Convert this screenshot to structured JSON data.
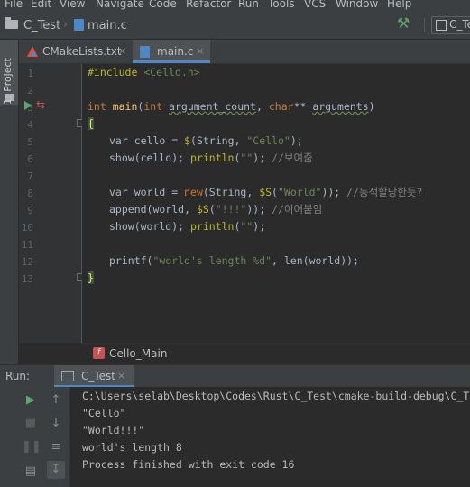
{
  "menu": [
    "File",
    "Edit",
    "View",
    "Navigate",
    "Code",
    "Refactor",
    "Run",
    "Tools",
    "VCS",
    "Window",
    "Help"
  ],
  "navbar": {
    "project": "C_Test",
    "file": "main.c",
    "run_config": "C_Te"
  },
  "sidebar": {
    "project_tab": "1: Project"
  },
  "tabs": [
    {
      "label": "CMakeLists.txt",
      "close": "×"
    },
    {
      "label": "main.c",
      "close": "×"
    }
  ],
  "editor": {
    "line_numbers": [
      "1",
      "2",
      "3",
      "4",
      "5",
      "6",
      "7",
      "8",
      "9",
      "10",
      "11",
      "12",
      "13"
    ],
    "lines": {
      "l1_inc": "#include ",
      "l1_hdr": "<Cello.h>",
      "l3_int1": "int ",
      "l3_main": "main",
      "l3_p1": "(",
      "l3_int2": "int ",
      "l3_argc": "argument_count",
      "l3_comma": ", ",
      "l3_char": "char",
      "l3_stars": "** ",
      "l3_argv": "arguments",
      "l3_close": ")",
      "l4_brace": "{",
      "l5_a": "var cello = ",
      "l5_mac": "$",
      "l5_b": "(String, ",
      "l5_str": "\"Cello\"",
      "l5_c": ");",
      "l6_a": "show(cello); ",
      "l6_fn": "println",
      "l6_b": "(",
      "l6_str": "\"\"",
      "l6_c": "); ",
      "l6_cm": "//보여줌",
      "l8_a": "var world = ",
      "l8_new": "new",
      "l8_b": "(String, ",
      "l8_mac": "$S",
      "l8_c": "(",
      "l8_str": "\"World\"",
      "l8_d": ")); ",
      "l8_cm": "//동적할당한듯?",
      "l9_a": "append(world, ",
      "l9_mac": "$S",
      "l9_b": "(",
      "l9_str": "\"!!!\"",
      "l9_c": ")); ",
      "l9_cm": "//이어붙임",
      "l10_a": "show(world); ",
      "l10_fn": "println",
      "l10_b": "(",
      "l10_str": "\"\"",
      "l10_c": ");",
      "l12_a": "printf(",
      "l12_str": "\"world's length %d\"",
      "l12_b": ", len(world));",
      "l13_brace": "}"
    }
  },
  "breadcrumb": {
    "icon": "f",
    "function": "Cello_Main"
  },
  "run_panel": {
    "label": "Run:",
    "tab": "C_Test",
    "tab_close": "×"
  },
  "console": [
    "C:\\Users\\selab\\Desktop\\Codes\\Rust\\C_Test\\cmake-build-debug\\C_Test.exe",
    "\"Cello\"",
    "\"World!!!\"",
    "world's length 8",
    "Process finished with exit code 16"
  ],
  "colors": {
    "keyword": "#cc7832",
    "function": "#ffc66d",
    "string": "#6a8759",
    "comment": "#808080",
    "macro": "#bbb529",
    "accent": "#4a88c7",
    "run_green": "#59a869"
  }
}
